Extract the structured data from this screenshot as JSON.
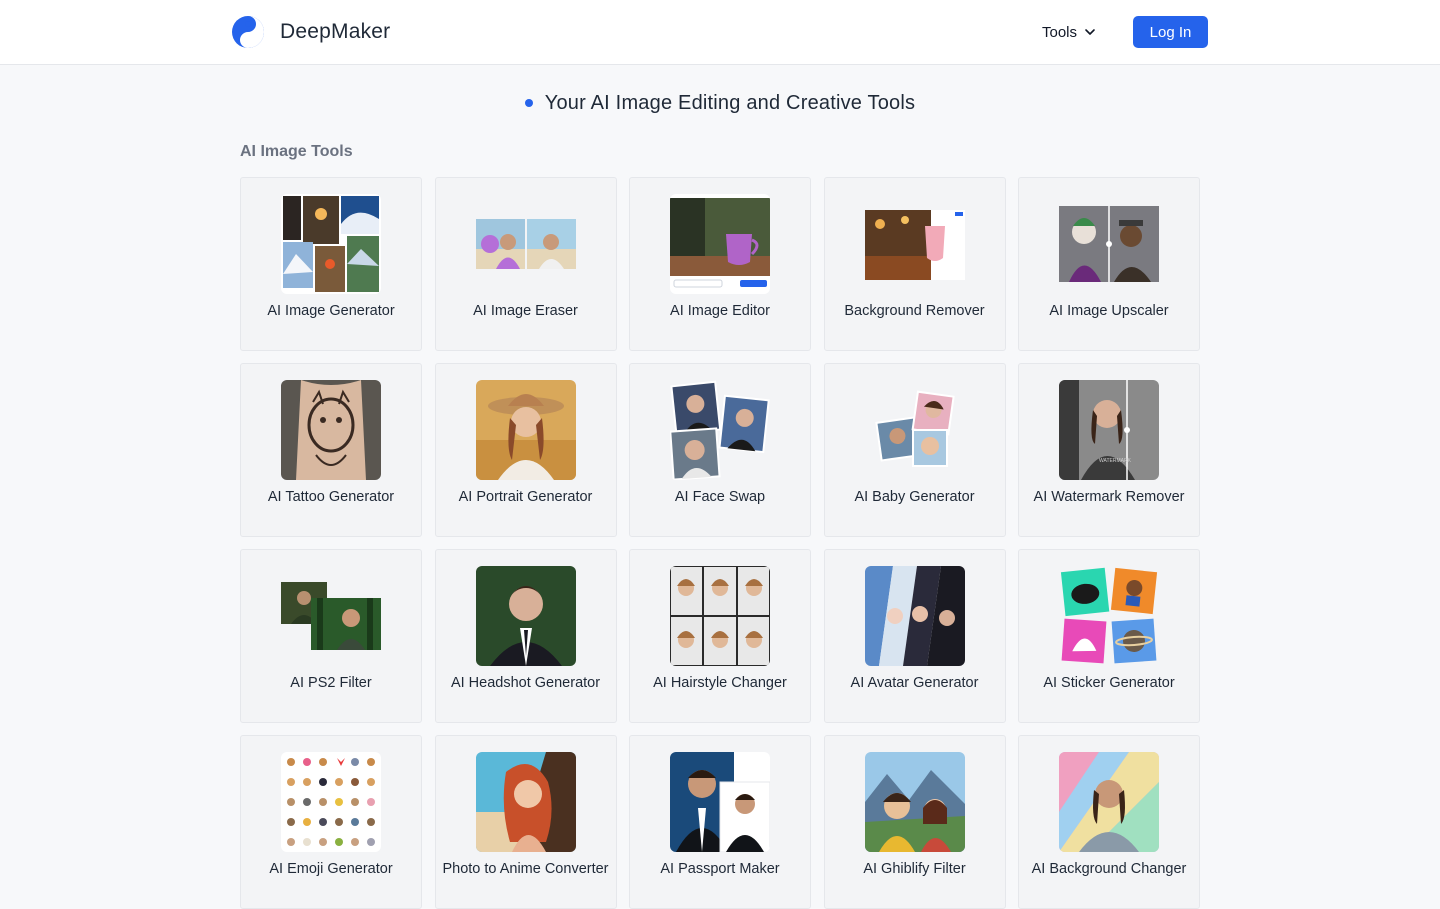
{
  "header": {
    "brand_name": "DeepMaker",
    "tools_label": "Tools",
    "login_label": "Log In",
    "accent_color": "#2563eb"
  },
  "hero": {
    "title": "Your AI Image Editing and Creative Tools"
  },
  "section": {
    "title": "AI Image Tools"
  },
  "tools": [
    {
      "label": "AI Image Generator",
      "icon": "image-generator-thumbnail"
    },
    {
      "label": "AI Image Eraser",
      "icon": "image-eraser-thumbnail"
    },
    {
      "label": "AI Image Editor",
      "icon": "image-editor-thumbnail"
    },
    {
      "label": "Background Remover",
      "icon": "background-remover-thumbnail"
    },
    {
      "label": "AI Image Upscaler",
      "icon": "image-upscaler-thumbnail"
    },
    {
      "label": "AI Tattoo Generator",
      "icon": "tattoo-generator-thumbnail"
    },
    {
      "label": "AI Portrait Generator",
      "icon": "portrait-generator-thumbnail"
    },
    {
      "label": "AI Face Swap",
      "icon": "face-swap-thumbnail"
    },
    {
      "label": "AI Baby Generator",
      "icon": "baby-generator-thumbnail"
    },
    {
      "label": "AI Watermark Remover",
      "icon": "watermark-remover-thumbnail"
    },
    {
      "label": "AI PS2 Filter",
      "icon": "ps2-filter-thumbnail"
    },
    {
      "label": "AI Headshot Generator",
      "icon": "headshot-generator-thumbnail"
    },
    {
      "label": "AI Hairstyle Changer",
      "icon": "hairstyle-changer-thumbnail"
    },
    {
      "label": "AI Avatar Generator",
      "icon": "avatar-generator-thumbnail"
    },
    {
      "label": "AI Sticker Generator",
      "icon": "sticker-generator-thumbnail"
    },
    {
      "label": "AI Emoji Generator",
      "icon": "emoji-generator-thumbnail"
    },
    {
      "label": "Photo to Anime Converter",
      "icon": "anime-converter-thumbnail"
    },
    {
      "label": "AI Passport Maker",
      "icon": "passport-maker-thumbnail"
    },
    {
      "label": "AI Ghiblify Filter",
      "icon": "ghiblify-filter-thumbnail"
    },
    {
      "label": "AI Background Changer",
      "icon": "background-changer-thumbnail"
    }
  ]
}
